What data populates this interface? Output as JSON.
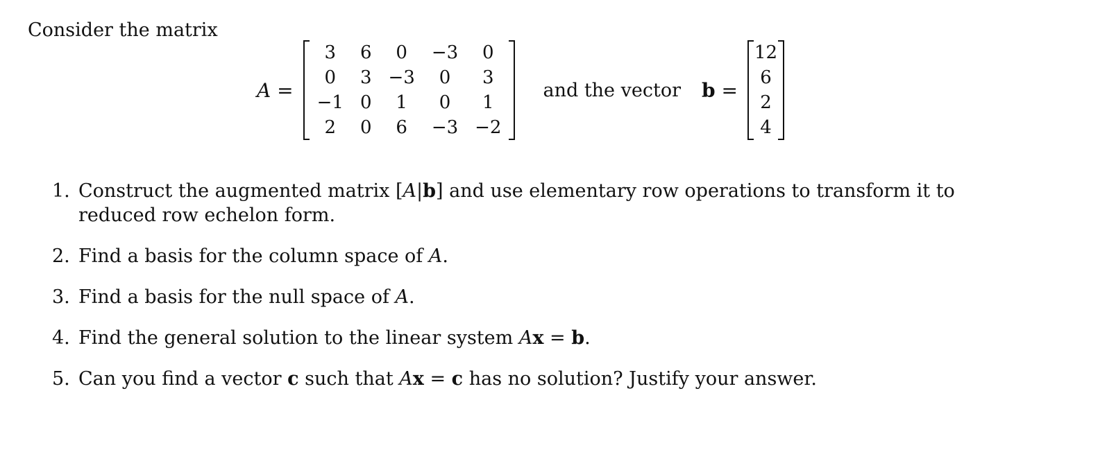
{
  "intro": "Consider the matrix",
  "matrix_A": {
    "label": "A =",
    "rows": [
      [
        "3",
        "6",
        "0",
        "−3",
        "0"
      ],
      [
        "0",
        "3",
        "−3",
        "0",
        "3"
      ],
      [
        "−1",
        "0",
        "1",
        "0",
        "1"
      ],
      [
        "2",
        "0",
        "6",
        "−3",
        "−2"
      ]
    ]
  },
  "connector": "and the vector",
  "vector_b": {
    "label": "b =",
    "values": [
      "12",
      "6",
      "2",
      "4"
    ]
  },
  "questions": [
    {
      "num": "1.",
      "text": "Construct the augmented matrix [A|b] and use elementary row operations to transform it to reduced row echelon form."
    },
    {
      "num": "2.",
      "text": "Find a basis for the column space of A."
    },
    {
      "num": "3.",
      "text": "Find a basis for the null space of A."
    },
    {
      "num": "4.",
      "text": "Find the general solution to the linear system Ax = b."
    },
    {
      "num": "5.",
      "text": "Can you find a vector c such that Ax = c has no solution? Justify your answer."
    }
  ]
}
